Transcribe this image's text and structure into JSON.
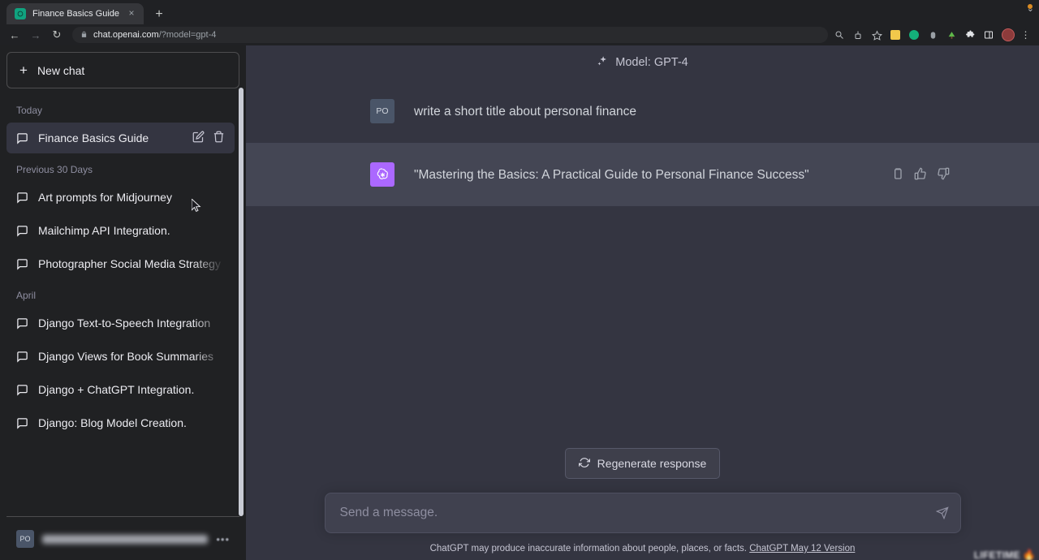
{
  "browser": {
    "tab": {
      "title": "Finance Basics Guide",
      "favicon": "chatgpt-favicon",
      "close_label": "×"
    },
    "new_tab_label": "+",
    "window_minimize": "⌄",
    "nav": {
      "back": "←",
      "forward": "→",
      "reload": "↻"
    },
    "omnibox": {
      "lock": "🔒",
      "domain": "chat.openai.com",
      "path": "/?model=gpt-4"
    },
    "toolbar_icons": [
      {
        "name": "zoom-icon",
        "glyph": "⊕"
      },
      {
        "name": "share-icon",
        "glyph": "⎙"
      },
      {
        "name": "bookmark-star-icon",
        "glyph": "☆"
      },
      {
        "name": "notes-extension-icon",
        "color": "#f2c84b"
      },
      {
        "name": "grammarly-extension-icon",
        "color": "#14b07a"
      },
      {
        "name": "mouse-extension-icon",
        "color": "#9aa0a6"
      },
      {
        "name": "tree-extension-icon",
        "color": "#5fb84a"
      },
      {
        "name": "puzzle-extensions-icon",
        "glyph": "❖"
      },
      {
        "name": "sidepanel-icon",
        "glyph": "◧"
      },
      {
        "name": "profile-avatar",
        "color": "#8d3b3b"
      },
      {
        "name": "chrome-menu-icon",
        "glyph": "⋮"
      }
    ]
  },
  "sidebar": {
    "new_chat_label": "New chat",
    "new_chat_plus": "+",
    "groups": [
      {
        "label": "Today",
        "items": [
          {
            "title": "Finance Basics Guide",
            "active": true
          }
        ]
      },
      {
        "label": "Previous 30 Days",
        "items": [
          {
            "title": "Art prompts for Midjourney",
            "active": false
          },
          {
            "title": "Mailchimp API Integration.",
            "active": false
          },
          {
            "title": "Photographer Social Media Strategy",
            "active": false
          }
        ]
      },
      {
        "label": "April",
        "items": [
          {
            "title": "Django Text-to-Speech Integration",
            "active": false
          },
          {
            "title": "Django Views for Book Summaries",
            "active": false
          },
          {
            "title": "Django + ChatGPT Integration.",
            "active": false
          },
          {
            "title": "Django: Blog Model Creation.",
            "active": false
          }
        ]
      }
    ],
    "row_actions": {
      "edit": "edit-icon",
      "delete": "trash-icon"
    },
    "footer": {
      "avatar_initials": "PO",
      "menu_dots": "•••"
    }
  },
  "main": {
    "header": {
      "model_label": "Model: GPT-4",
      "sparkle_icon": "sparkles-icon"
    },
    "messages": [
      {
        "role": "user",
        "avatar_initials": "PO",
        "text": "write a short title about personal finance"
      },
      {
        "role": "assistant",
        "avatar_icon": "openai-logo",
        "text": "\"Mastering the Basics: A Practical Guide to Personal Finance Success\"",
        "actions": [
          "copy-icon",
          "thumbs-up-icon",
          "thumbs-down-icon"
        ]
      }
    ],
    "regenerate_label": "Regenerate response",
    "composer": {
      "placeholder": "Send a message.",
      "value": "",
      "send_icon": "send-icon"
    },
    "footnote_main": "ChatGPT may produce inaccurate information about people, places, or facts.",
    "footnote_link": "ChatGPT May 12 Version"
  },
  "watermark": {
    "text": "LIFETIME",
    "flame": "🔥"
  },
  "colors": {
    "sidebar_bg": "#202123",
    "chat_bg": "#343541",
    "assistant_bg": "#444654",
    "accent_purple": "#ab68ff",
    "brand_green": "#10a37f"
  }
}
